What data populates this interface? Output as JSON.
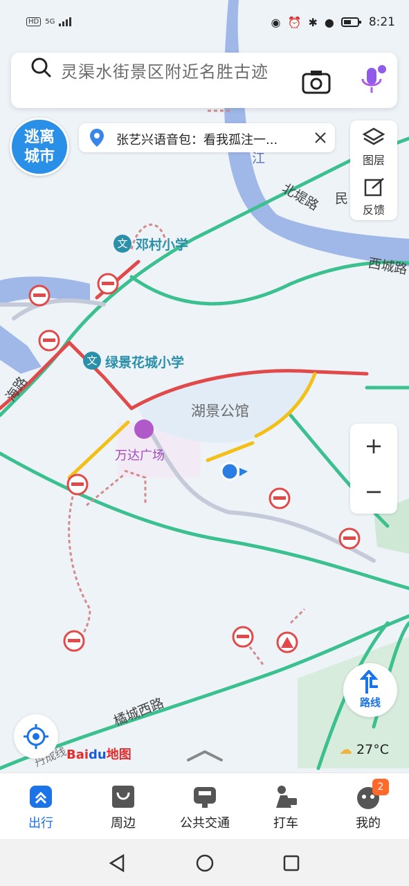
{
  "status": {
    "network": "HD",
    "signal": "5G",
    "time": "8:21"
  },
  "search": {
    "placeholder": "灵渠水街景区附近名胜古迹"
  },
  "promo": {
    "line1": "逃离",
    "line2": "城市"
  },
  "voice_pack": {
    "text": "张艺兴语音包：看我孤注一..."
  },
  "side_panel": {
    "layers_label": "图层",
    "feedback_label": "反馈"
  },
  "zoom": {
    "in": "+",
    "out": "−"
  },
  "route_button": {
    "label": "路线"
  },
  "map_labels": {
    "school1": "邓村小学",
    "school2": "绿景花城小学",
    "mall": "万达广场",
    "residence": "湖景公馆",
    "road_beidi": "北堤路",
    "road_xicheng": "西城路",
    "road_min": "民",
    "river": "江",
    "road_hai": "海路",
    "road_qiaocheng": "橘城西路",
    "road_line": "丹成线"
  },
  "logo": {
    "bai": "Bai",
    "du": "du",
    "map": "地图"
  },
  "weather": {
    "temp": "27°C"
  },
  "tabs": [
    {
      "label": "出行",
      "active": true
    },
    {
      "label": "周边",
      "active": false
    },
    {
      "label": "公共交通",
      "active": false
    },
    {
      "label": "打车",
      "active": false
    },
    {
      "label": "我的",
      "active": false,
      "badge": "2"
    }
  ],
  "colors": {
    "accent": "#1a73e8",
    "road_green": "#3cc08f",
    "road_red": "#e04a4a",
    "road_yellow": "#f2c019",
    "water": "#9fb8e8",
    "badge": "#ff6a2a"
  }
}
